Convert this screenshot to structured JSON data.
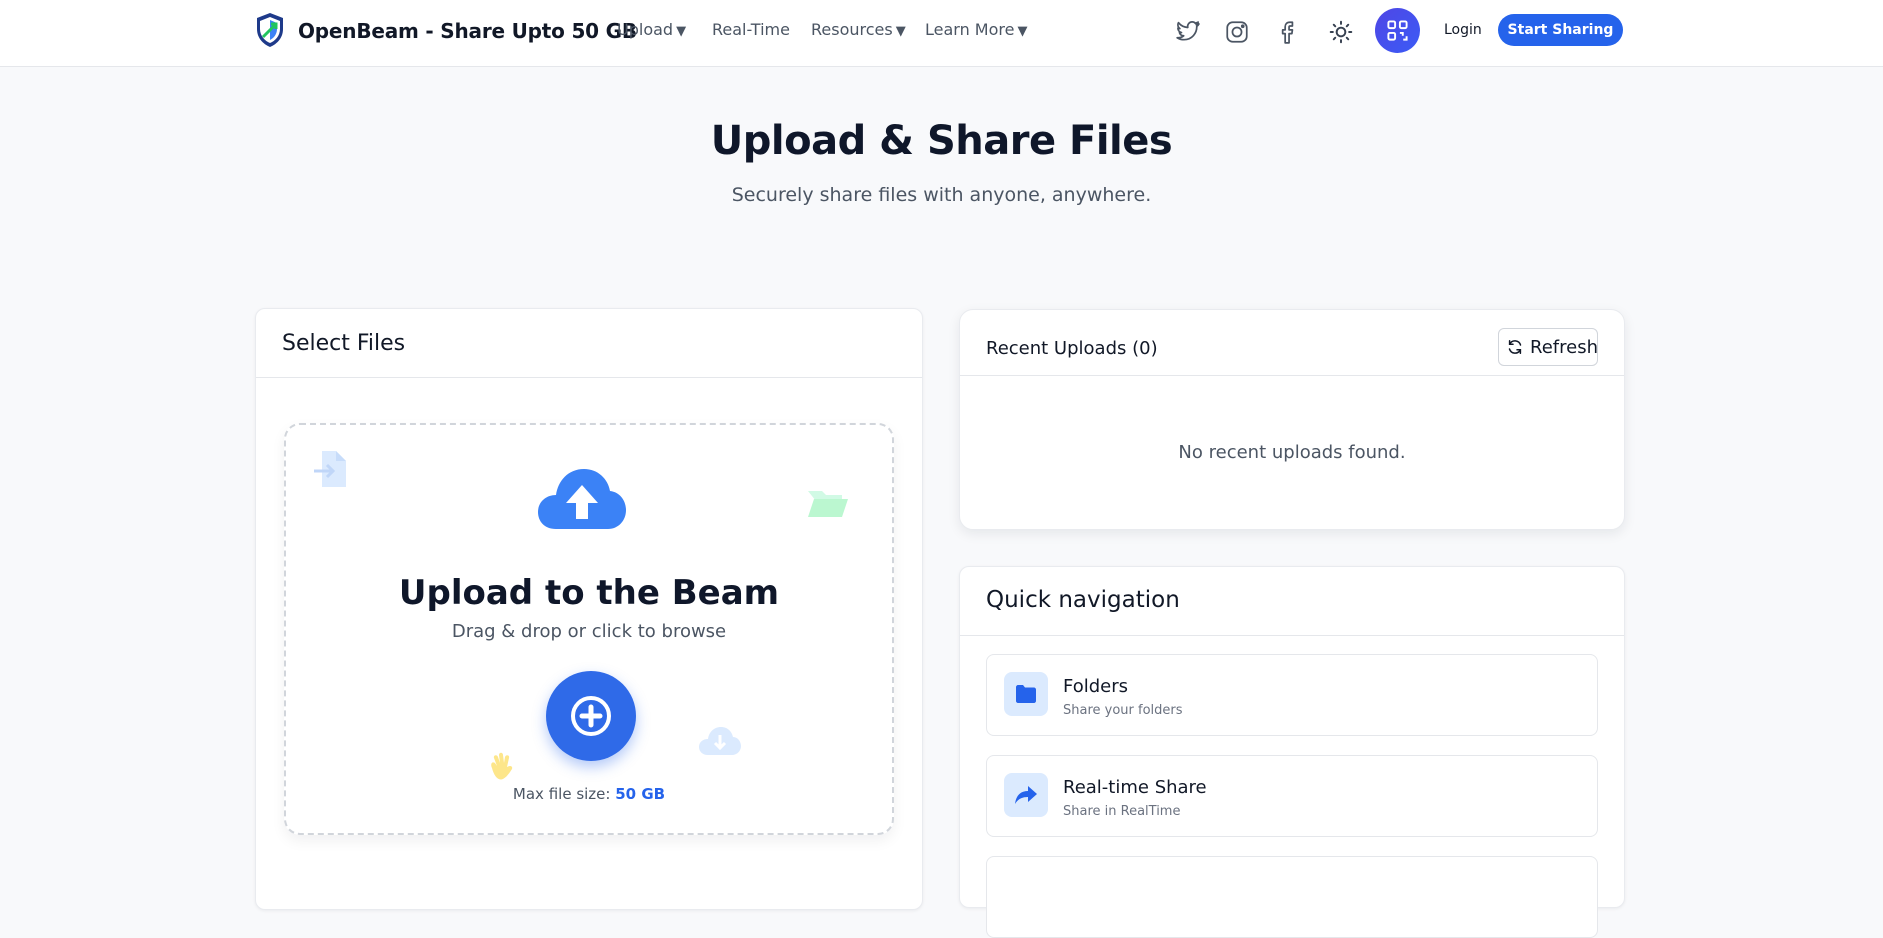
{
  "header": {
    "brand": "OpenBeam - Share Upto 50 GB",
    "nav": [
      {
        "label": "Upload",
        "caret": "▼"
      },
      {
        "label": "Real-Time"
      },
      {
        "label": "Resources",
        "caret": "▼"
      },
      {
        "label": "Learn More",
        "caret": "▼"
      }
    ],
    "icons": [
      "twitter-icon",
      "instagram-icon",
      "facebook-icon",
      "sun-icon",
      "qr-code-icon"
    ],
    "login": "Login",
    "cta": "Start Sharing"
  },
  "hero": {
    "title": "Upload & Share Files",
    "subtitle": "Securely share files with anyone, anywhere."
  },
  "upload": {
    "card_title": "Select Files",
    "title": "Upload to the Beam",
    "subtitle": "Drag & drop or click to browse",
    "max_label": "Max file size: ",
    "max_value": "50 GB"
  },
  "recent": {
    "title": "Recent Uploads (0)",
    "refresh": "Refresh",
    "empty": "No recent uploads found."
  },
  "quick_nav": {
    "title": "Quick navigation",
    "items": [
      {
        "title": "Folders",
        "subtitle": "Share your folders",
        "icon": "folder-icon"
      },
      {
        "title": "Real-time Share",
        "subtitle": "Share in RealTime",
        "icon": "share-arrow-icon"
      }
    ]
  },
  "colors": {
    "accent": "#2563eb",
    "qr_button": "#4f46e5",
    "background": "#f8f9fb"
  }
}
